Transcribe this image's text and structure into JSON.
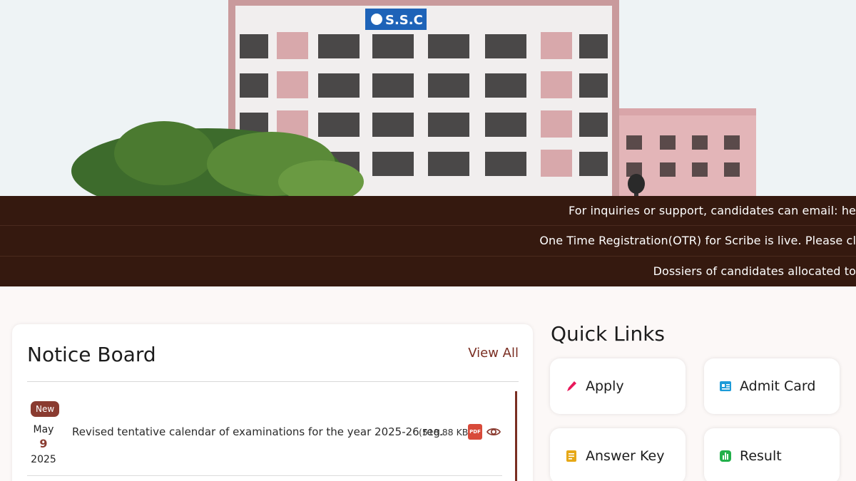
{
  "hero": {
    "building_sign": "S.S.C"
  },
  "ticker": {
    "lines": [
      "For inquiries or support, candidates can email: he",
      "One Time Registration(OTR) for Scribe is live. Please cl",
      "Dossiers of candidates allocated to"
    ]
  },
  "notice_board": {
    "title": "Notice Board",
    "view_all": "View All",
    "items": [
      {
        "badge": "New",
        "month": "May",
        "day": "9",
        "year": "2025",
        "text": "Revised tentative calendar of examinations for the year 2025-26 reg.",
        "size": "(518.88 KB)",
        "pdf_label": "PDF"
      }
    ]
  },
  "quick_links": {
    "title": "Quick Links",
    "items": [
      {
        "label": "Apply",
        "icon": "pencil-icon",
        "color": "#e8185a"
      },
      {
        "label": "Admit Card",
        "icon": "id-card-icon",
        "color": "#1d9bd8"
      },
      {
        "label": "Answer Key",
        "icon": "document-icon",
        "color": "#e6a817"
      },
      {
        "label": "Result",
        "icon": "bar-chart-icon",
        "color": "#22b04b"
      }
    ]
  },
  "colors": {
    "brand_dark": "#35190f",
    "accent": "#7a2e22"
  }
}
